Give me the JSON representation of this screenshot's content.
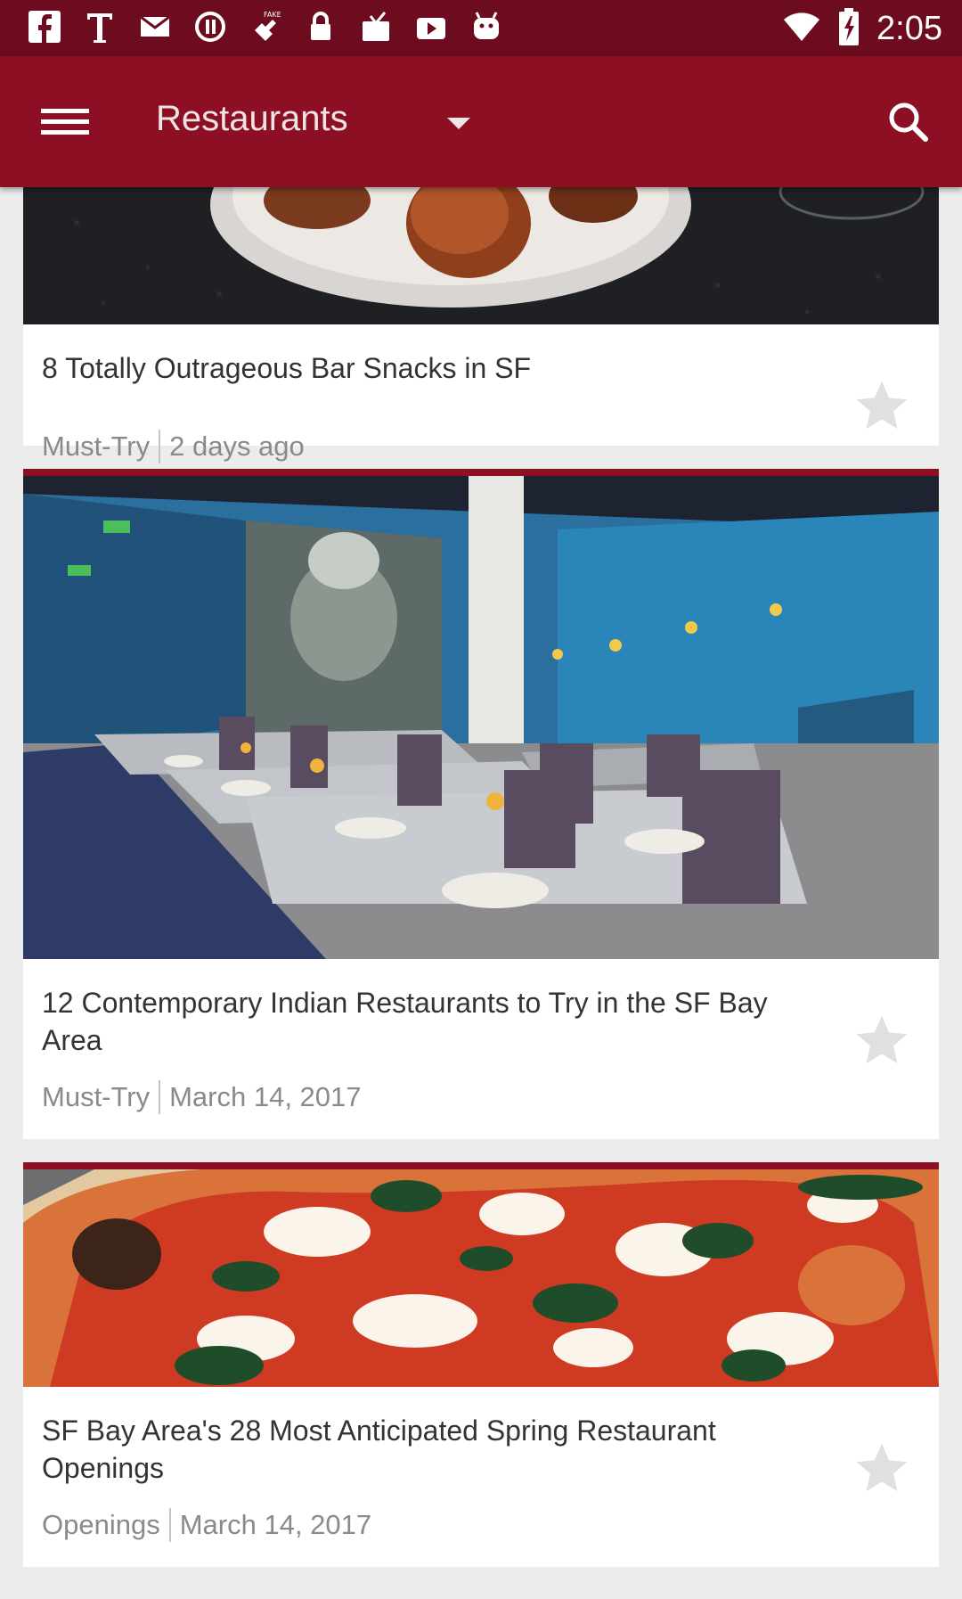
{
  "status_bar": {
    "time": "2:05",
    "icons_left": [
      "facebook-icon",
      "text-t-icon",
      "mail-icon",
      "sync-icon",
      "fake-gps-icon",
      "lock-icon",
      "inbox-icon",
      "youtube-icon",
      "android-icon"
    ],
    "icons_right": [
      "wifi-icon",
      "battery-charging-icon"
    ]
  },
  "app_bar": {
    "title": "Restaurants",
    "menu_icon": "hamburger-menu-icon",
    "dropdown_icon": "caret-down-icon",
    "search_icon": "search-icon"
  },
  "colors": {
    "status_bar": "#6d0c1e",
    "app_bar": "#8c0f24",
    "background": "#ececec",
    "star_inactive": "#e0e0e0"
  },
  "articles": [
    {
      "title": "8 Totally Outrageous Bar Snacks in SF",
      "category": "Must-Try",
      "date": "2 days ago",
      "image": "plated-bar-snacks-photo",
      "bookmarked": false
    },
    {
      "title": "12 Contemporary Indian Restaurants to Try in the SF Bay Area",
      "category": "Must-Try",
      "date": "March 14, 2017",
      "image": "restaurant-dining-room-photo",
      "bookmarked": false
    },
    {
      "title": "SF Bay Area's 28 Most Anticipated Spring Restaurant Openings",
      "category": "Openings",
      "date": "March 14, 2017",
      "image": "margherita-pizza-photo",
      "bookmarked": false
    }
  ]
}
